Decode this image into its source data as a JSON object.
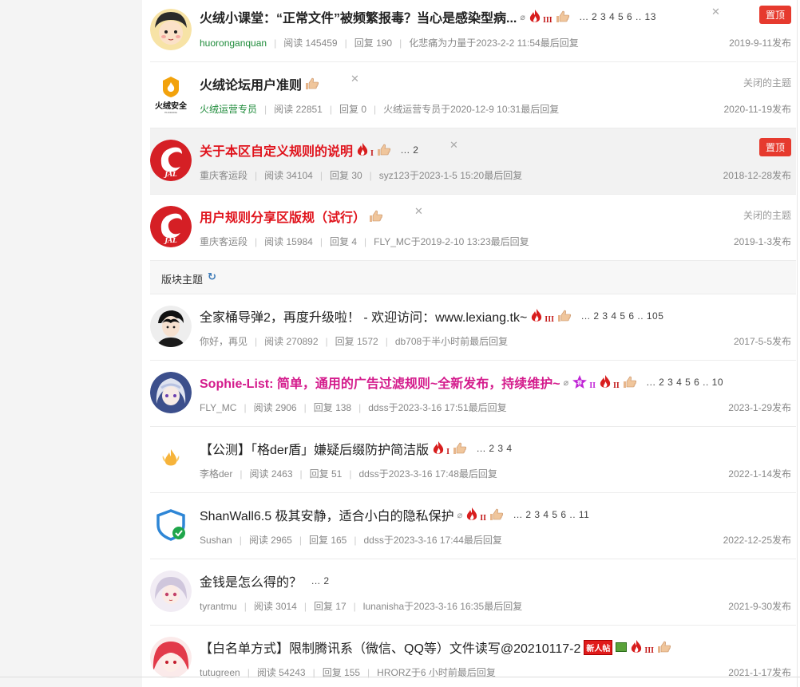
{
  "section": {
    "label": "版块主题",
    "refresh_icon": "refresh-icon"
  },
  "pinned": [
    {
      "title": "火绒小课堂：“正常文件”被频繁报毒？当心是感染型病...",
      "author": "huoronganquan",
      "reads": "阅读 145459",
      "replies": "回复 190",
      "last": "化悲痛为力量于2023-2-2 11:54最后回复",
      "date": "2019-9-11发布",
      "pages": "... 2 3 4 5 6 .. 13",
      "pin_label": "置顶",
      "heat": "III"
    },
    {
      "title": "火绒论坛用户准则",
      "author": "火绒运营专员",
      "reads": "阅读 22851",
      "replies": "回复 0",
      "last": "火绒运营专员于2020-12-9 10:31最后回复",
      "date": "2020-11-19发布",
      "status": "关闭的主题"
    },
    {
      "title": "关于本区自定义规则的说明",
      "author": "重庆客运段",
      "reads": "阅读 34104",
      "replies": "回复 30",
      "last": "syz123于2023-1-5 15:20最后回复",
      "date": "2018-12-28发布",
      "pages": "... 2",
      "pin_label": "置顶",
      "heat": "I"
    },
    {
      "title": "用户规则分享区版规（试行）",
      "author": "重庆客运段",
      "reads": "阅读 15984",
      "replies": "回复 4",
      "last": "FLY_MC于2019-2-10 13:23最后回复",
      "date": "2019-1-3发布",
      "status": "关闭的主题"
    }
  ],
  "threads": [
    {
      "title": "全家桶导弹2，再度升级啦！ - 欢迎访问：www.lexiang.tk~",
      "author": "你好，再见",
      "reads": "阅读 270892",
      "replies": "回复 1572",
      "last": "db708于半小时前最后回复",
      "date": "2017-5-5发布",
      "pages": "... 2 3 4 5 6 .. 105",
      "heat": "III"
    },
    {
      "title": "Sophie-List: 简单，通用的广告过滤规则~全新发布，持续维护~",
      "author": "FLY_MC",
      "reads": "阅读 2906",
      "replies": "回复 138",
      "last": "ddss于2023-3-16 17:51最后回复",
      "date": "2023-1-29发布",
      "pages": "... 2 3 4 5 6 .. 10",
      "heat": "II",
      "star": "II"
    },
    {
      "title": "【公测】「格der盾」嫌疑后缀防护简洁版",
      "author": "李格der",
      "reads": "阅读 2463",
      "replies": "回复 51",
      "last": "ddss于2023-3-16 17:48最后回复",
      "date": "2022-1-14发布",
      "pages": "... 2 3 4",
      "heat": "I"
    },
    {
      "title": "ShanWall6.5 极其安静，适合小白的隐私保护",
      "author": "Sushan",
      "reads": "阅读 2965",
      "replies": "回复 165",
      "last": "ddss于2023-3-16 17:44最后回复",
      "date": "2022-12-25发布",
      "pages": "... 2 3 4 5 6 .. 11",
      "heat": "II"
    },
    {
      "title": "金钱是怎么得的？",
      "author": "tyrantmu",
      "reads": "阅读 3014",
      "replies": "回复 17",
      "last": "lunanisha于2023-3-16 16:35最后回复",
      "date": "2021-9-30发布",
      "pages": "... 2"
    },
    {
      "title": "【白名单方式】限制腾讯系（微信、QQ等）文件读写@20210117-2",
      "author": "tutugreen",
      "reads": "阅读 54243",
      "replies": "回复 155",
      "last": "HRORZ于6 小时前最后回复",
      "date": "2021-1-17发布",
      "new_badge": "新人帖",
      "heat": "III"
    }
  ],
  "colors": {
    "pin": "#e63a2e",
    "red_title": "#e0131c",
    "pink_title": "#d41b8c",
    "green_author": "#1e8b3a"
  }
}
